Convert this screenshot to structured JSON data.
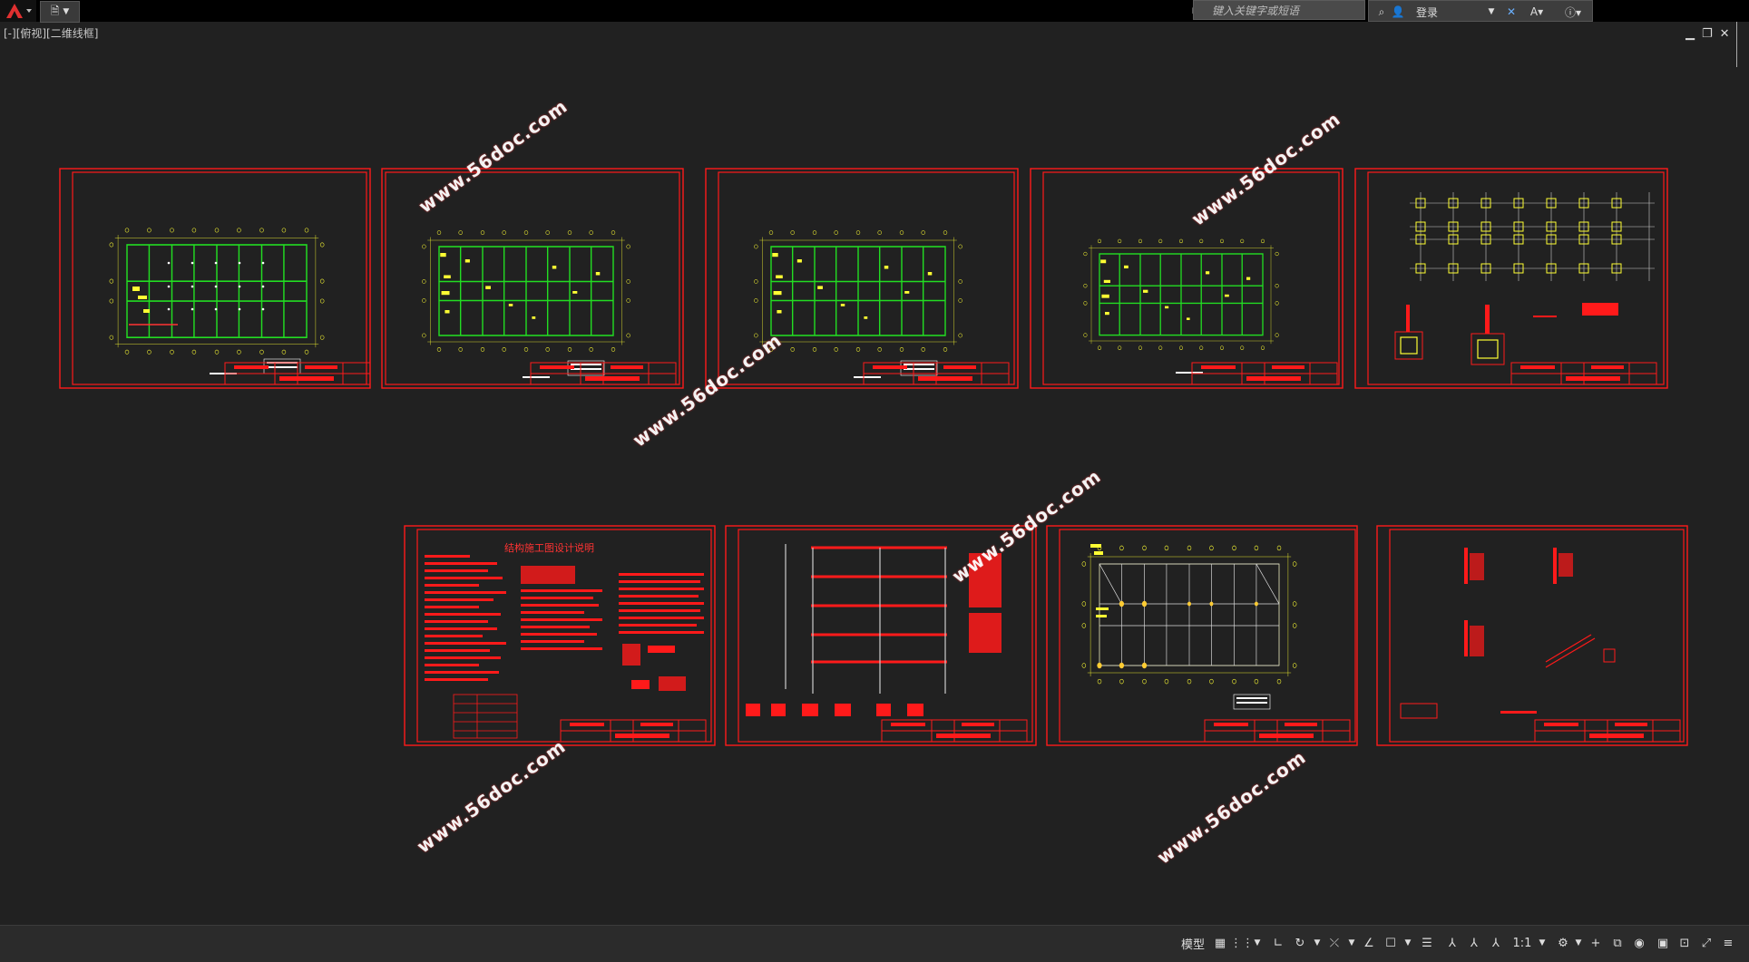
{
  "top": {
    "search_placeholder": "键入关键字或短语",
    "login_label": "登录"
  },
  "viewport": {
    "label": "[-][俯视][二维线框]"
  },
  "sheets": {
    "notes_title": "结构施工图设计说明"
  },
  "watermark": {
    "text": "www.56doc.com"
  },
  "status": {
    "model_label": "模型",
    "scale_label": "1:1"
  },
  "colors": {
    "background": "#212121",
    "sheet_border": "#ff1a1a",
    "axis_yellow": "#ffff33",
    "beam_green": "#22dd22"
  }
}
